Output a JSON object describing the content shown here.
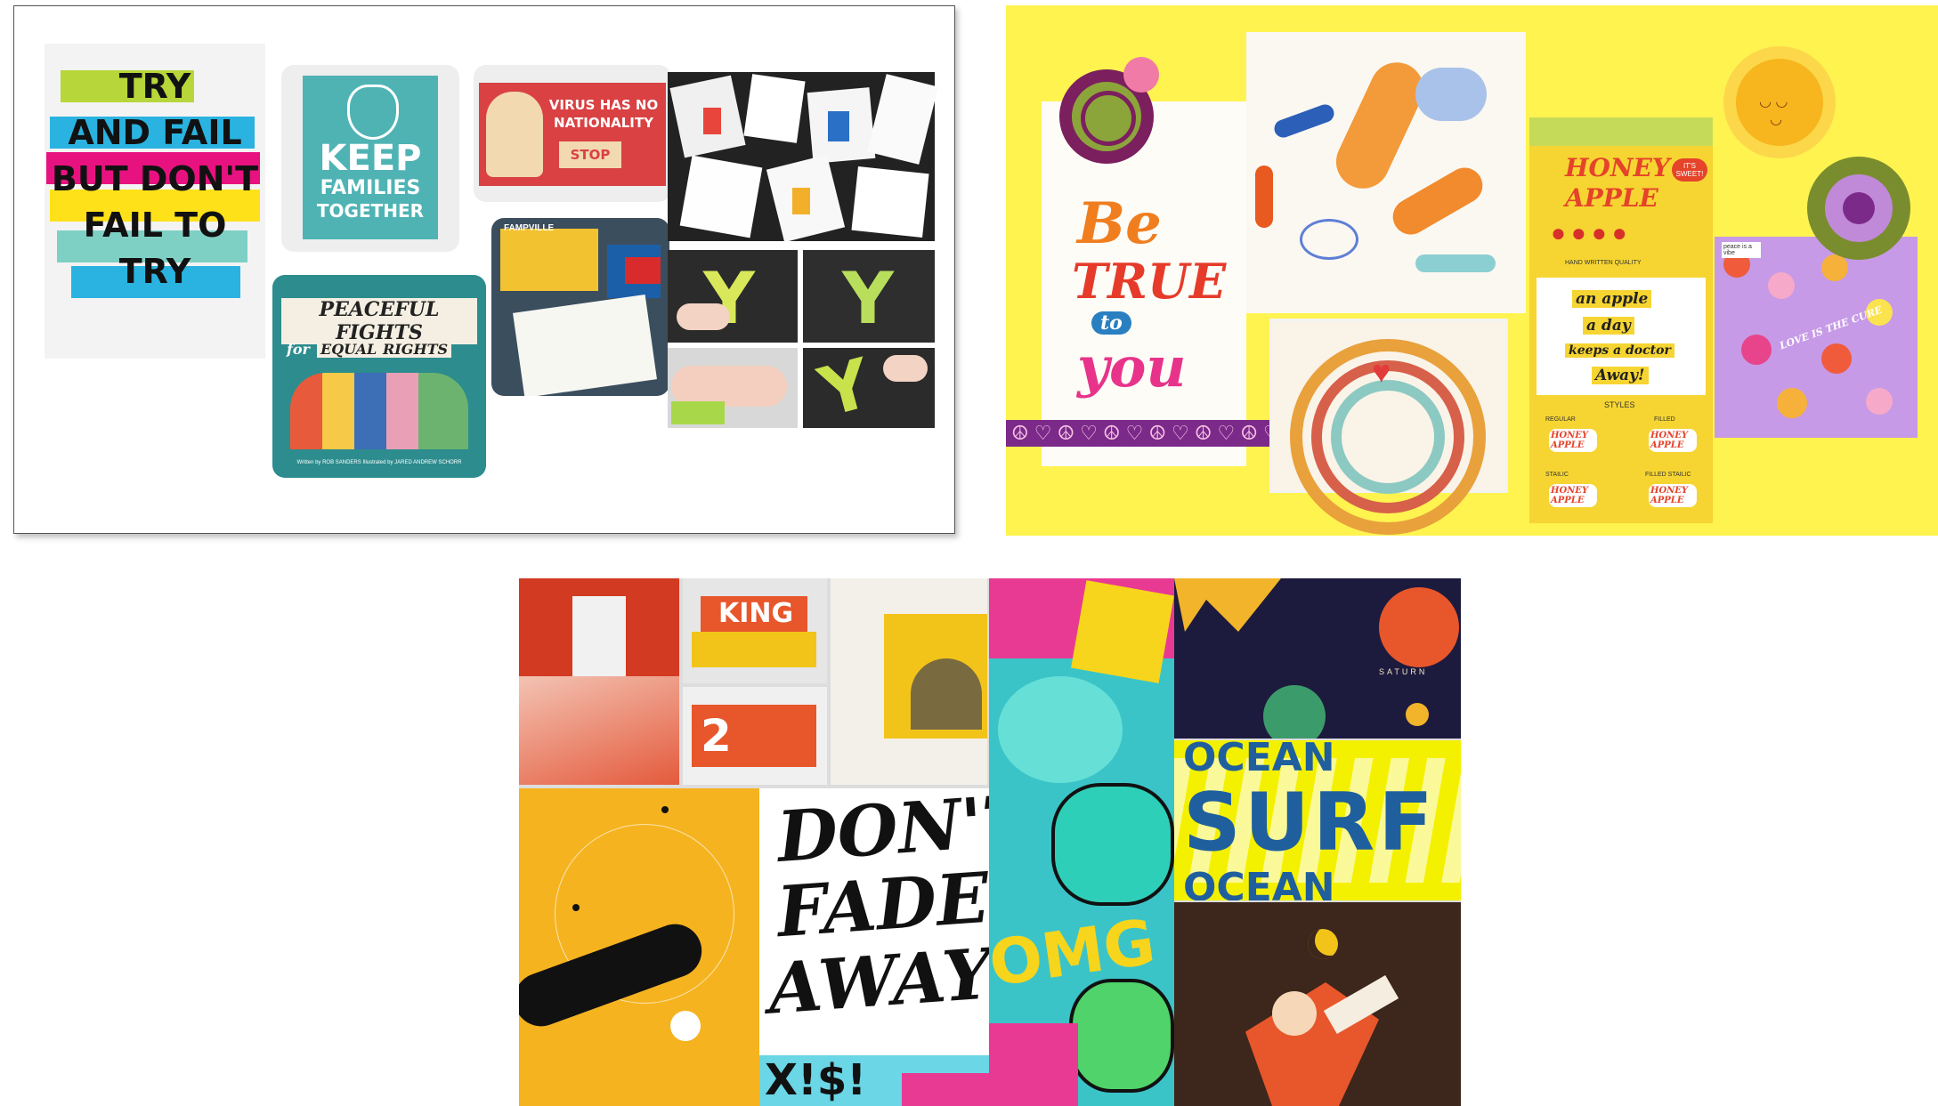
{
  "board1": {
    "try_poster": [
      "TRY",
      "AND FAIL",
      "BUT DON'T",
      "FAIL TO",
      "TRY"
    ],
    "keep_poster": [
      "KEEP",
      "FAMILIES",
      "TOGETHER"
    ],
    "virus_poster": {
      "line1": "VIRUS HAS NO",
      "line2": "NATIONALITY",
      "stop": "STOP"
    },
    "book": {
      "title": "PEACEFUL FIGHTS",
      "sub1": "for",
      "sub2": "EQUAL",
      "sub3": "RIGHTS",
      "credits": "Written by ROB SANDERS  Illustrated by JARED ANDREW SCHORR"
    },
    "stamp_label": "FAMPVILLE",
    "sponge_letter": "Y"
  },
  "board2": {
    "be_true": [
      "Be",
      "TRUE",
      "to",
      "you"
    ],
    "honey_apple": {
      "title1": "HONEY",
      "title2": "APPLE",
      "badge": "IT'S SWEET!",
      "sub": "HAND WRITTEN QUALITY"
    },
    "apple_day": [
      "an apple",
      "a day",
      "keeps a doctor",
      "Away!"
    ],
    "styles": [
      "STYLES",
      "REGULAR",
      "FILLED",
      "STAILIC",
      "FILLED STAILIC"
    ],
    "honey_small": "HONEY APPLE",
    "flowers_text": "LOVE IS THE CURE",
    "sticker_text": "peace is a vibe"
  },
  "board3": {
    "wayfinding": "KING",
    "floor_number": "2",
    "saturn": "SATURN",
    "dont_fade": [
      "DON'T",
      "FADE",
      "AWAY"
    ],
    "ocean": [
      "OCEAN",
      "SURF",
      "OCEAN"
    ],
    "omg": "OMG",
    "symbols": "X!$!"
  },
  "colors": {
    "yellow": "#fff34f",
    "poster_teal": "#4fb3b4",
    "poster_red": "#d94143",
    "mustard": "#f6b320"
  }
}
